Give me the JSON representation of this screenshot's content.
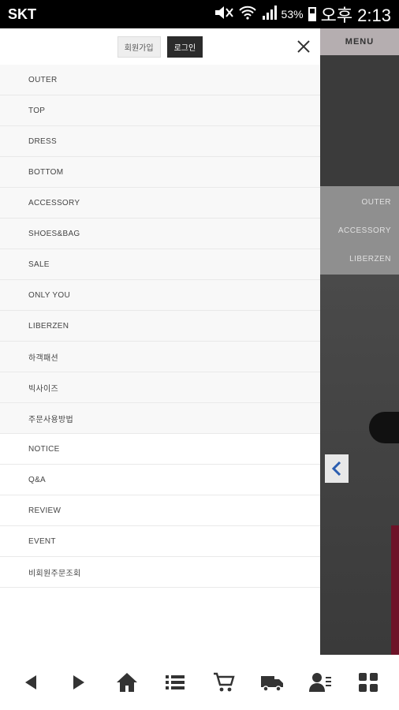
{
  "status_bar": {
    "carrier": "SKT",
    "battery": "53%",
    "time": "오후 2:13",
    "icons": [
      "mute-icon",
      "wifi-icon",
      "signal-icon",
      "battery-icon"
    ]
  },
  "background_page": {
    "menu_label": "MENU",
    "categories": [
      "OUTER",
      "ACCESSORY",
      "LIBERZEN"
    ],
    "prev_arrow_icon": "chevron-left-icon"
  },
  "drawer": {
    "join_label": "회원가입",
    "login_label": "로그인",
    "close_icon": "close-icon",
    "categories": [
      "OUTER",
      "TOP",
      "DRESS",
      "BOTTOM",
      "ACCESSORY",
      "SHOES&BAG",
      "SALE",
      "ONLY YOU",
      "LIBERZEN",
      "하객패션",
      "빅사이즈",
      "주문사용방법"
    ],
    "board_links": [
      "NOTICE",
      "Q&A",
      "REVIEW",
      "EVENT",
      "비회원주문조회"
    ]
  },
  "bottom_nav": {
    "icons": [
      "back-icon",
      "forward-icon",
      "home-icon",
      "list-icon",
      "cart-icon",
      "truck-icon",
      "user-icon",
      "grid-icon"
    ]
  },
  "colors": {
    "status_bar": "#000000",
    "login_button": "#2b2b2b",
    "nav_icon": "#333333",
    "accent_arrow": "#2a5db0"
  }
}
